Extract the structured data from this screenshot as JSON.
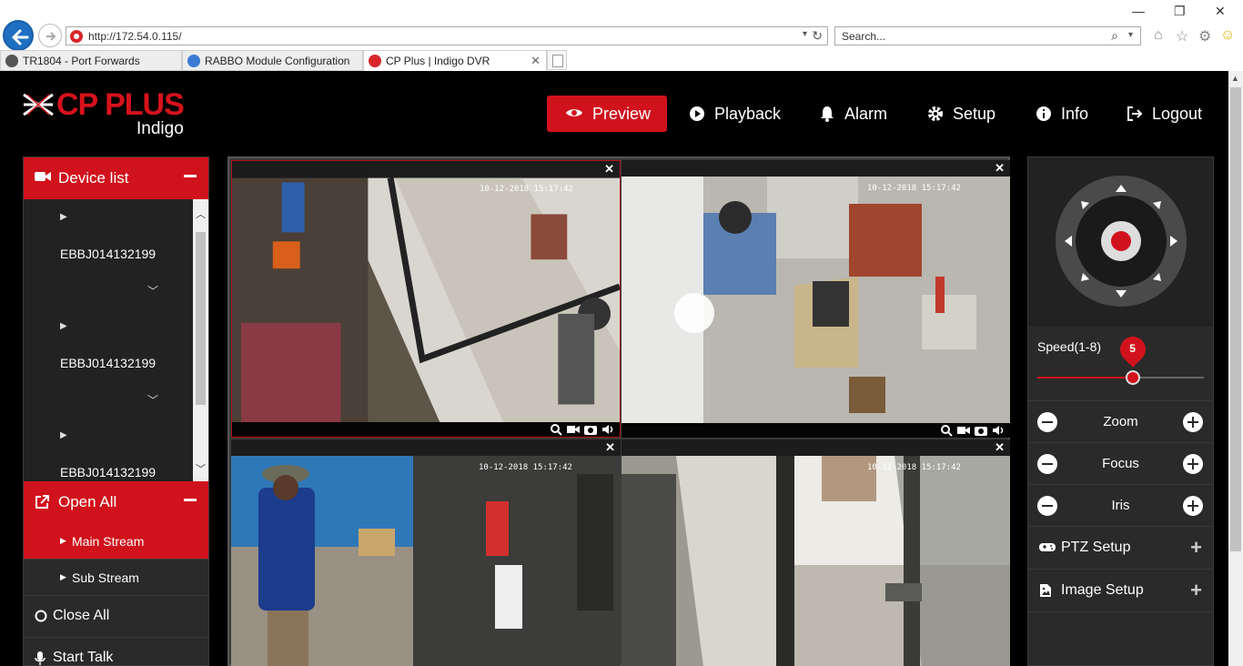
{
  "browser": {
    "url": "http://172.54.0.115/",
    "search_placeholder": "Search...",
    "tabs": [
      {
        "label": "TR1804 - Port Forwards"
      },
      {
        "label": "RABBO Module Configuration"
      },
      {
        "label": "CP Plus | Indigo DVR",
        "active": true
      }
    ]
  },
  "brand": {
    "name": "CP PLUS",
    "product": "Indigo",
    "color": "#d0121c"
  },
  "nav": {
    "preview": "Preview",
    "playback": "Playback",
    "alarm": "Alarm",
    "setup": "Setup",
    "info": "Info",
    "logout": "Logout"
  },
  "left_panel": {
    "device_list_title": "Device list",
    "devices": [
      "EBBJ014132199",
      "EBBJ014132199",
      "EBBJ014132199"
    ],
    "open_all": "Open All",
    "main_stream": "Main Stream",
    "sub_stream": "Sub Stream",
    "close_all": "Close All",
    "start_talk": "Start Talk"
  },
  "cameras": [
    {
      "timestamp": "10-12-2018 15:17:42",
      "selected": true
    },
    {
      "timestamp": "10-12-2018 15:17:42",
      "selected": false
    },
    {
      "timestamp": "10-12-2018 15:17:42",
      "selected": false
    },
    {
      "timestamp": "10-12-2018 15:17:42",
      "selected": false
    }
  ],
  "right_panel": {
    "speed_label": "Speed(1-8)",
    "speed_value": "5",
    "speed_min": 1,
    "speed_max": 8,
    "zoom": "Zoom",
    "focus": "Focus",
    "iris": "Iris",
    "ptz_setup": "PTZ Setup",
    "image_setup": "Image Setup"
  }
}
